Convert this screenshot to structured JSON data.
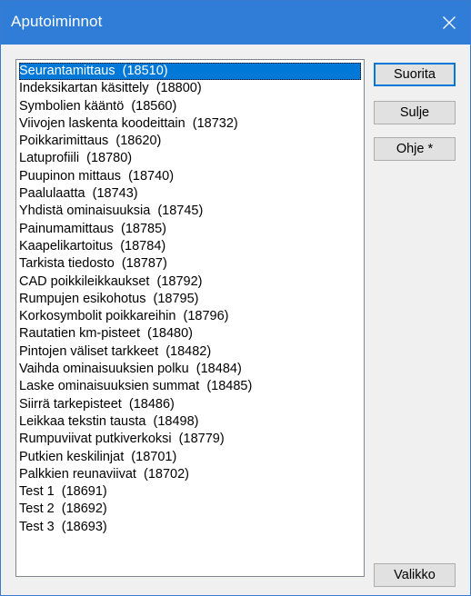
{
  "window": {
    "title": "Aputoiminnot",
    "close_icon": "close-icon",
    "accent_color": "#2f7dd6",
    "selection_color": "#0078d7"
  },
  "list": {
    "selected_index": 0,
    "items": [
      "Seurantamittaus  (18510)",
      "Indeksikartan käsittely  (18800)",
      "Symbolien kääntö  (18560)",
      "Viivojen laskenta koodeittain  (18732)",
      "Poikkarimittaus  (18620)",
      "Latuprofiili  (18780)",
      "Puupinon mittaus  (18740)",
      "Paalulaatta  (18743)",
      "Yhdistä ominaisuuksia  (18745)",
      "Painumamittaus  (18785)",
      "Kaapelikartoitus  (18784)",
      "Tarkista tiedosto  (18787)",
      "CAD poikkileikkaukset  (18792)",
      "Rumpujen esikohotus  (18795)",
      "Korkosymbolit poikkareihin  (18796)",
      "Rautatien km-pisteet  (18480)",
      "Pintojen väliset tarkkeet  (18482)",
      "Vaihda ominaisuuksien polku  (18484)",
      "Laske ominaisuuksien summat  (18485)",
      "Siirrä tarkepisteet  (18486)",
      "Leikkaa tekstin tausta  (18498)",
      "Rumpuviivat putkiverkoksi  (18779)",
      "Putkien keskilinjat  (18701)",
      "Palkkien reunaviivat  (18702)",
      "Test 1  (18691)",
      "Test 2  (18692)",
      "Test 3  (18693)"
    ]
  },
  "buttons": {
    "run": "Suorita",
    "close": "Sulje",
    "help": "Ohje *",
    "menu": "Valikko"
  }
}
